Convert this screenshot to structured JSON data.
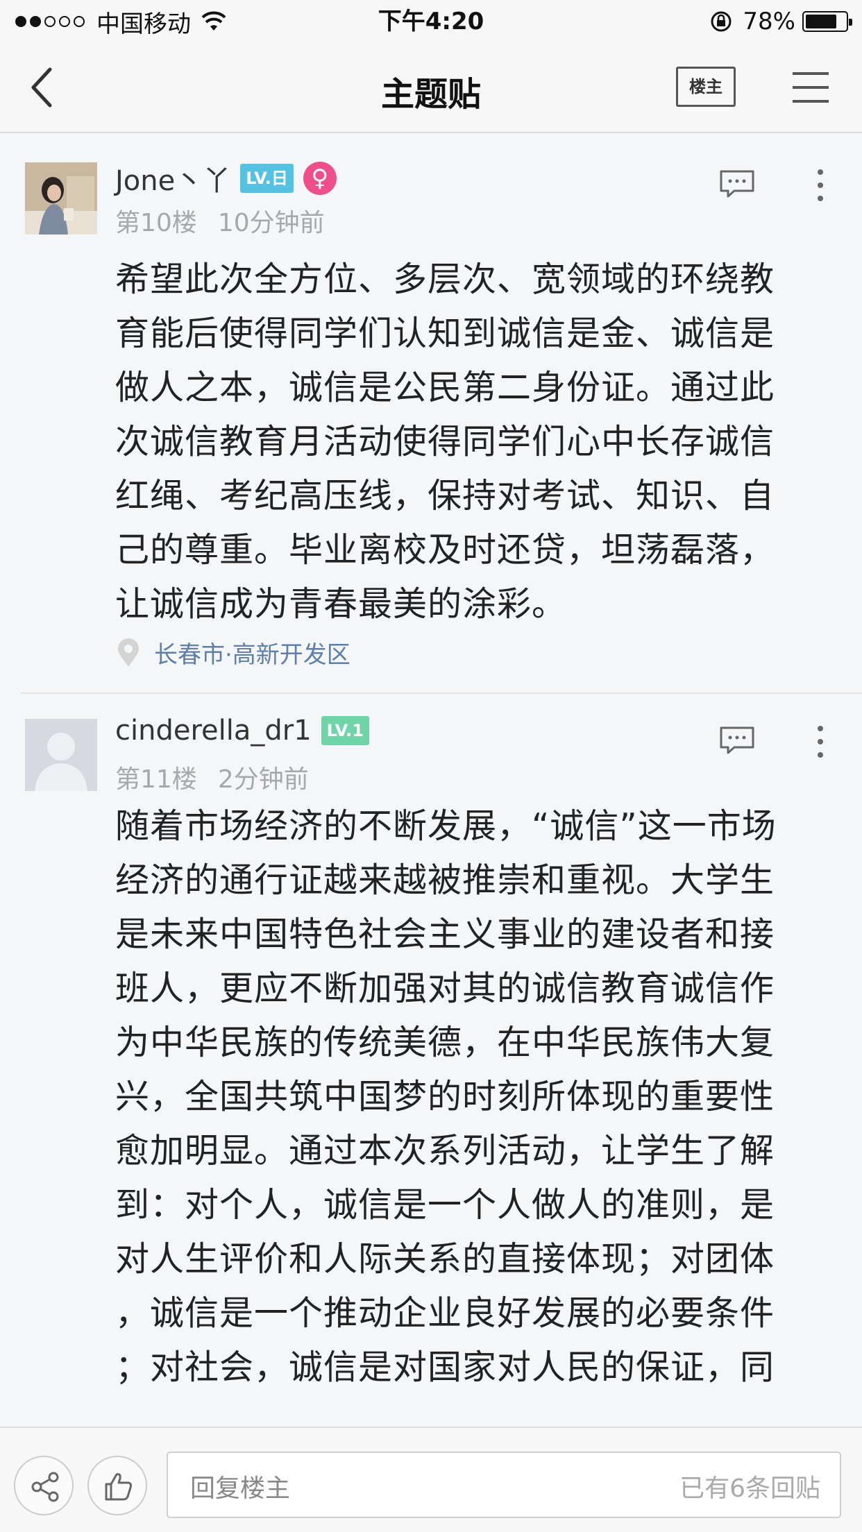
{
  "status_bar": {
    "carrier": "中国移动",
    "time": "下午4:20",
    "battery": "78%",
    "battery_level": 0.78,
    "signal_bars": 2
  },
  "nav": {
    "title": "主题贴",
    "owner_button": "楼主"
  },
  "posts": [
    {
      "username": "Jone丶丫",
      "level": "LV.日",
      "level_color": "#56c2e2",
      "gender_symbol": "♀",
      "floor": "第10楼",
      "time": "10分钟前",
      "lines": [
        "希望此次全方位、多层次、宽领域的环绕教",
        "育能后使得同学们认知到诚信是金、诚信是",
        "做人之本，诚信是公民第二身份证。通过此",
        "次诚信教育月活动使得同学们心中长存诚信",
        "红绳、考纪高压线，保持对考试、知识、自",
        "己的尊重。毕业离校及时还贷，坦荡磊落，",
        "让诚信成为青春最美的涂彩。"
      ],
      "location": "长春市·高新开发区"
    },
    {
      "username": "cinderella_dr1",
      "level": "LV.1",
      "level_color": "#6fd4a8",
      "floor": "第11楼",
      "time": "2分钟前",
      "lines": [
        "随着市场经济的不断发展，“诚信”这一市场",
        "经济的通行证越来越被推崇和重视。大学生",
        "是未来中国特色社会主义事业的建设者和接",
        "班人，更应不断加强对其的诚信教育诚信作",
        "为中华民族的传统美德，在中华民族伟大复",
        "兴，全国共筑中国梦的时刻所体现的重要性",
        "愈加明显。通过本次系列活动，让学生了解",
        "到：对个人，诚信是一个人做人的准则，是",
        "对人生评价和人际关系的直接体现；对团体",
        "，诚信是一个推动企业良好发展的必要条件",
        "；对社会，诚信是对国家对人民的保证，同"
      ]
    }
  ],
  "bottom_bar": {
    "reply_placeholder": "回复楼主",
    "reply_count": "已有6条回贴"
  },
  "icons": {
    "back": "back-arrow-icon",
    "menu": "hamburger-menu-icon",
    "comment": "comment-bubble-icon",
    "more": "more-vertical-icon",
    "location": "location-pin-icon",
    "share": "share-icon",
    "like": "thumbs-up-icon"
  }
}
